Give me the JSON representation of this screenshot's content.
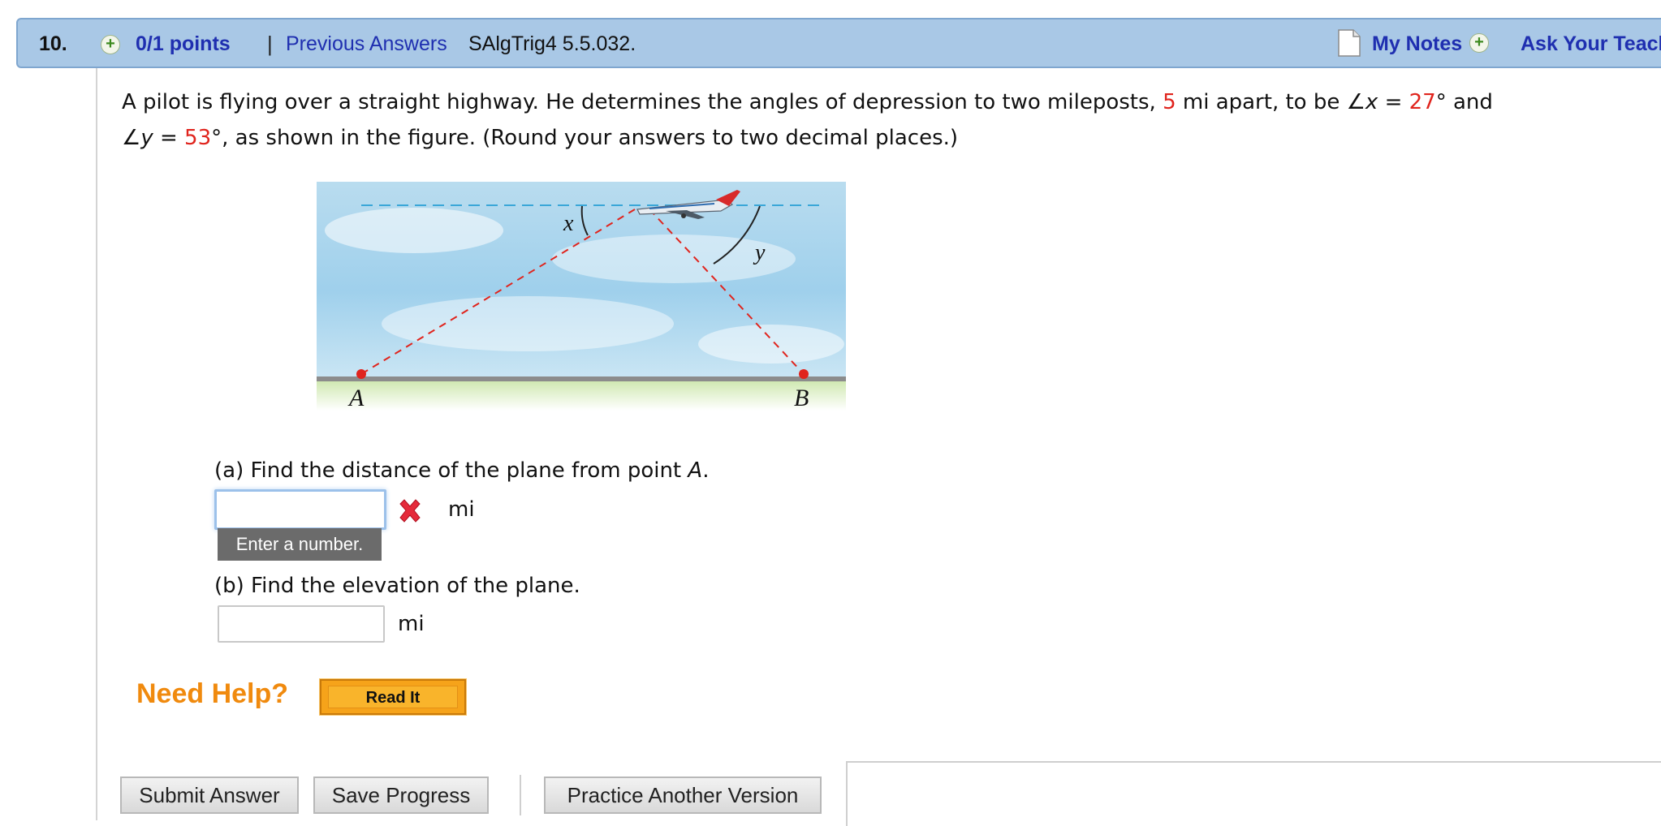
{
  "header": {
    "number": "10.",
    "points": "0/1 points",
    "separator": "|",
    "previous_answers": "Previous Answers",
    "question_id": "SAlgTrig4 5.5.032.",
    "my_notes": "My Notes",
    "ask_teacher": "Ask Your Teach"
  },
  "question": {
    "t1": "A pilot is flying over a straight highway. He determines the angles of depression to two mileposts, ",
    "distance": "5",
    "t2": " mi apart, to be ∠",
    "var_x": "x",
    "t3": " = ",
    "angle_x": "27",
    "t4": "° and",
    "t5": "∠",
    "var_y": "y",
    "t6": " = ",
    "angle_y": "53",
    "t7": "°, as shown in the figure. (Round your answers to two decimal places.)"
  },
  "figure": {
    "label_x": "x",
    "label_y": "y",
    "label_a": "A",
    "label_b": "B"
  },
  "part_a": {
    "prompt": "(a) Find the distance of the plane from point ",
    "point": "A",
    "period": ".",
    "value": "",
    "unit": "mi",
    "tooltip": "Enter a number."
  },
  "part_b": {
    "prompt": "(b) Find the elevation of the plane.",
    "value": "",
    "unit": "mi"
  },
  "help": {
    "need_help": "Need Help?",
    "read_it": "Read It"
  },
  "buttons": {
    "submit": "Submit Answer",
    "save": "Save Progress",
    "practice": "Practice Another Version"
  }
}
